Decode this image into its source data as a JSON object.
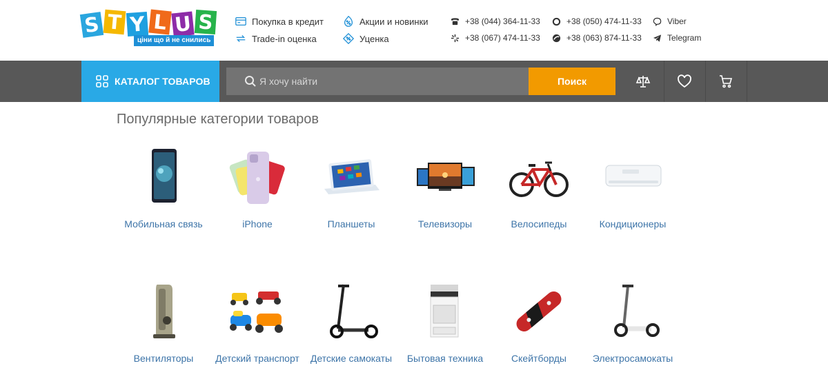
{
  "header": {
    "logo": {
      "word": "STYLUS",
      "tagline": "ціни що й не снились"
    },
    "links": [
      {
        "label": "Покупка в кредит",
        "icon": "credit-card-icon"
      },
      {
        "label": "Trade-in оценка",
        "icon": "trade-in-icon"
      },
      {
        "label": "Акции и новинки",
        "icon": "percent-icon"
      },
      {
        "label": "Уценка",
        "icon": "discount-tag-icon"
      }
    ],
    "phones": [
      {
        "number": "+38 (044) 364-11-33",
        "icon": "landline-phone-icon"
      },
      {
        "number": "+38 (067) 474-11-33",
        "icon": "kyivstar-icon"
      },
      {
        "number": "+38 (050) 474-11-33",
        "icon": "vodafone-icon"
      },
      {
        "number": "+38 (063) 874-11-33",
        "icon": "lifecell-icon"
      }
    ],
    "messengers": [
      {
        "label": "Viber",
        "icon": "viber-icon"
      },
      {
        "label": "Telegram",
        "icon": "telegram-icon"
      }
    ]
  },
  "navbar": {
    "catalog_label": "КАТАЛОГ ТОВАРОВ",
    "search_placeholder": "Я хочу найти",
    "search_button": "Поиск",
    "icons": [
      "compare-icon",
      "heart-icon",
      "cart-icon"
    ]
  },
  "popular": {
    "title": "Популярные категории товаров",
    "categories": [
      {
        "name": "Мобильная связь",
        "icon": "smartphone-image"
      },
      {
        "name": "iPhone",
        "icon": "iphone-image"
      },
      {
        "name": "Планшеты",
        "icon": "tablet-image"
      },
      {
        "name": "Телевизоры",
        "icon": "tv-image"
      },
      {
        "name": "Велосипеды",
        "icon": "bicycle-image"
      },
      {
        "name": "Кондиционеры",
        "icon": "air-conditioner-image"
      },
      {
        "name": "Вентиляторы",
        "icon": "fan-image"
      },
      {
        "name": "Детский транспорт",
        "icon": "kids-vehicles-image"
      },
      {
        "name": "Детские самокаты",
        "icon": "kids-scooter-image"
      },
      {
        "name": "Бытовая техника",
        "icon": "stove-image"
      },
      {
        "name": "Скейтборды",
        "icon": "skateboard-image"
      },
      {
        "name": "Электросамокаты",
        "icon": "electric-scooter-image"
      }
    ]
  },
  "colors": {
    "accent_blue": "#29a9e6",
    "search_orange": "#f29a00",
    "bar_grey": "#585858",
    "link_blue": "#3d74a8"
  }
}
